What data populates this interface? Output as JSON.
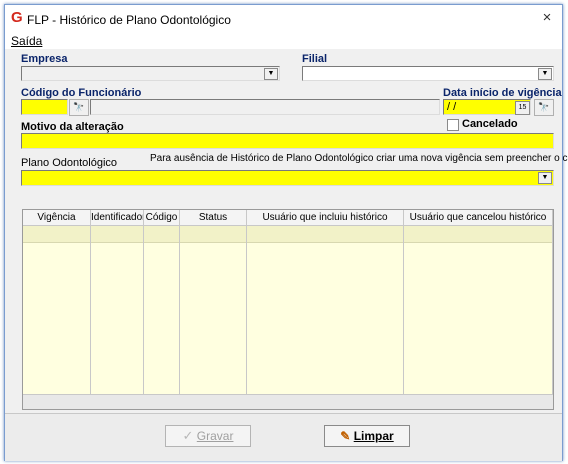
{
  "window": {
    "title": "FLP - Histórico de Plano Odontológico",
    "close": "×"
  },
  "menu": {
    "saida": "Saída"
  },
  "form": {
    "empresa_label": "Empresa",
    "filial_label": "Filial",
    "codigo_label": "Código do Funcionário",
    "data_label": "Data início de vigência",
    "data_value": " / /",
    "calendar_glyph": "15",
    "cancelado_label": "Cancelado",
    "motivo_label": "Motivo da alteração",
    "plano_label": "Plano Odontológico",
    "plano_hint": "Para ausência de Histórico de Plano Odontológico criar uma nova vigência sem preencher o código",
    "dropdown_glyph": "▼",
    "lookup_glyph": "🔭"
  },
  "grid": {
    "columns": [
      "Vigência",
      "Identificador",
      "Código",
      "Status",
      "Usuário que incluiu histórico",
      "Usuário que cancelou histórico"
    ]
  },
  "buttons": {
    "gravar": "Gravar",
    "limpar": "Limpar"
  },
  "colors": {
    "required_field": "#ffff00",
    "grid_bg": "#ffffe0",
    "label_blue": "#0a246a",
    "app_red": "#d42a1e"
  }
}
